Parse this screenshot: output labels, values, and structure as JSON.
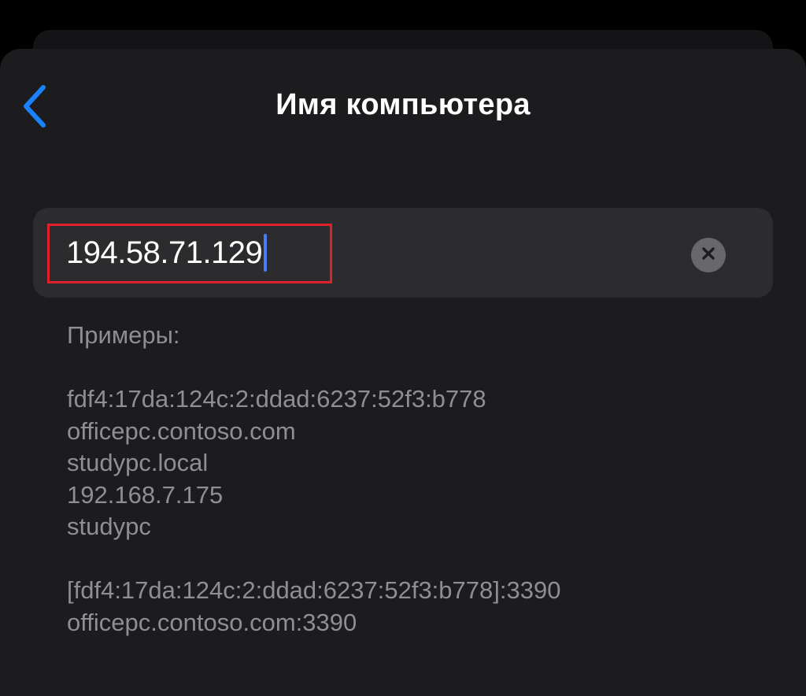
{
  "nav": {
    "title": "Имя компьютера",
    "back_icon": "chevron-left-icon",
    "accent_color": "#1a82fb"
  },
  "field": {
    "value": "194.58.71.129",
    "clear_icon": "clear-x-icon",
    "highlight_color": "#e1212a",
    "caret_color": "#4a7cf6"
  },
  "examples": {
    "heading": "Примеры:",
    "group1": [
      "fdf4:17da:124c:2:ddad:6237:52f3:b778",
      "officepc.contoso.com",
      "studypc.local",
      "192.168.7.175",
      "studypc"
    ],
    "group2": [
      "[fdf4:17da:124c:2:ddad:6237:52f3:b778]:3390",
      "officepc.contoso.com:3390"
    ]
  }
}
